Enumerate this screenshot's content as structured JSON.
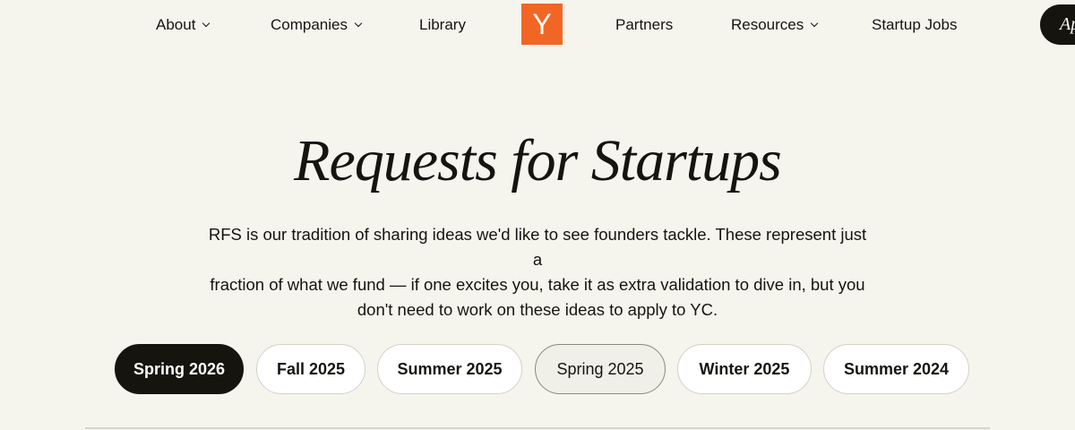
{
  "nav": {
    "items": [
      {
        "label": "About",
        "dropdown": true
      },
      {
        "label": "Companies",
        "dropdown": true
      },
      {
        "label": "Library",
        "dropdown": false
      },
      {
        "label": "Partners",
        "dropdown": false
      },
      {
        "label": "Resources",
        "dropdown": true
      },
      {
        "label": "Startup Jobs",
        "dropdown": false
      }
    ],
    "logo_text": "Y",
    "apply_label": "Ap"
  },
  "hero": {
    "title": "Requests for Startups",
    "intro_lines": [
      "RFS is our tradition of sharing ideas we'd like to see founders tackle. These represent just a",
      "fraction of what we fund — if one excites you, take it as extra validation to dive in, but you",
      "don't need to work on these ideas to apply to YC."
    ]
  },
  "tabs": {
    "items": [
      {
        "label": "Spring 2026",
        "active": true
      },
      {
        "label": "Fall 2025",
        "active": false
      },
      {
        "label": "Summer 2025",
        "active": false
      },
      {
        "label": "Spring 2025",
        "active": false,
        "hovered": true
      },
      {
        "label": "Winter 2025",
        "active": false
      },
      {
        "label": "Summer 2024",
        "active": false
      }
    ]
  },
  "colors": {
    "background": "#f5f5ee",
    "brand_orange": "#f26625",
    "text": "#16140f",
    "active_tab": "#16140f"
  },
  "icons": {
    "dropdown": "chevron-down-icon"
  }
}
